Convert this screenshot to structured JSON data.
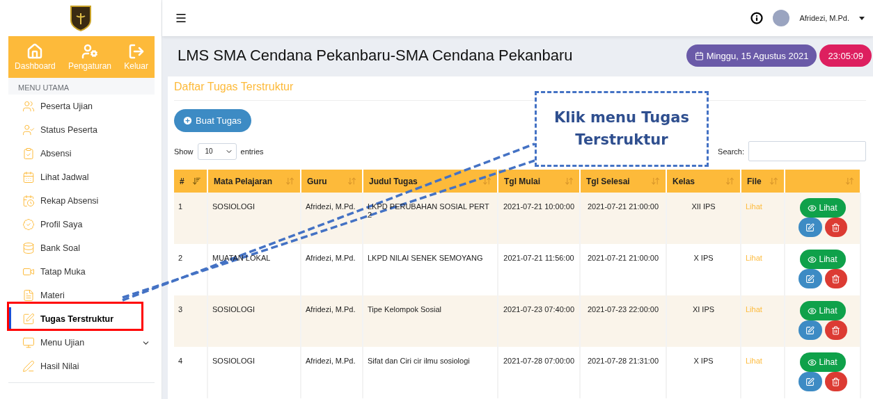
{
  "sidebar": {
    "nav_buttons": [
      {
        "label": "Dashboard"
      },
      {
        "label": "Pengaturan"
      },
      {
        "label": "Keluar"
      }
    ],
    "section_title": "MENU UTAMA",
    "items": [
      {
        "label": "Peserta Ujian",
        "selected": false,
        "kind": "link"
      },
      {
        "label": "Status Peserta",
        "selected": false,
        "kind": "link"
      },
      {
        "label": "Absensi",
        "selected": false,
        "kind": "link"
      },
      {
        "label": "Lihat Jadwal",
        "selected": false,
        "kind": "link"
      },
      {
        "label": "Rekap Absensi",
        "selected": false,
        "kind": "link"
      },
      {
        "label": "Profil Saya",
        "selected": false,
        "kind": "link"
      },
      {
        "label": "Bank Soal",
        "selected": false,
        "kind": "link"
      },
      {
        "label": "Tatap Muka",
        "selected": false,
        "kind": "link"
      },
      {
        "label": "Materi",
        "selected": false,
        "kind": "link"
      },
      {
        "label": "Tugas Terstruktur",
        "selected": true,
        "kind": "link"
      },
      {
        "label": "Menu Ujian",
        "selected": false,
        "kind": "submenu"
      },
      {
        "label": "Hasil Nilai",
        "selected": false,
        "kind": "link"
      }
    ]
  },
  "topbar": {
    "user": "Afridezi, M.Pd."
  },
  "header": {
    "title": "LMS SMA Cendana Pekanbaru-SMA Cendana Pekanbaru",
    "date": "Minggu, 15 Agustus 2021",
    "time": "23:05:09"
  },
  "card": {
    "title": "Daftar Tugas Terstruktur",
    "add_button": "Buat Tugas",
    "show_label": "Show",
    "page_size": "10",
    "entries_label": "entries",
    "search_label": "Search:",
    "columns": [
      "#",
      "Mata Pelajaran",
      "Guru",
      "Judul Tugas",
      "Tgl Mulai",
      "Tgl Selesai",
      "Kelas",
      "File"
    ],
    "rows": [
      {
        "cells": [
          "1",
          "SOSIOLOGI",
          "Afridezi, M.Pd.",
          "LKPD PERUBAHAN SOSIAL PERT 2",
          "2021-07-21 10:00:00",
          "2021-07-21 21:00:00",
          "XII IPS"
        ],
        "file": "Lihat",
        "view": "Lihat"
      },
      {
        "cells": [
          "2",
          "MUATAN LOKAL",
          "Afridezi, M.Pd.",
          "LKPD NILAI SENEK SEMOYANG",
          "2021-07-21 11:56:00",
          "2021-07-21 21:00:00",
          "X IPS"
        ],
        "file": "Lihat",
        "view": "Lihat"
      },
      {
        "cells": [
          "3",
          "SOSIOLOGI",
          "Afridezi, M.Pd.",
          "Tipe Kelompok Sosial",
          "2021-07-23 07:40:00",
          "2021-07-23 22:00:00",
          "XI IPS"
        ],
        "file": "Lihat",
        "view": "Lihat"
      },
      {
        "cells": [
          "4",
          "SOSIOLOGI",
          "Afridezi, M.Pd.",
          "Sifat dan Ciri cir ilmu sosiologi",
          "2021-07-28 07:00:00",
          "2021-07-28 21:31:00",
          "X IPS"
        ],
        "file": "Lihat",
        "view": "Lihat"
      }
    ]
  },
  "annotation": {
    "text": "Klik menu Tugas Terstruktur"
  }
}
